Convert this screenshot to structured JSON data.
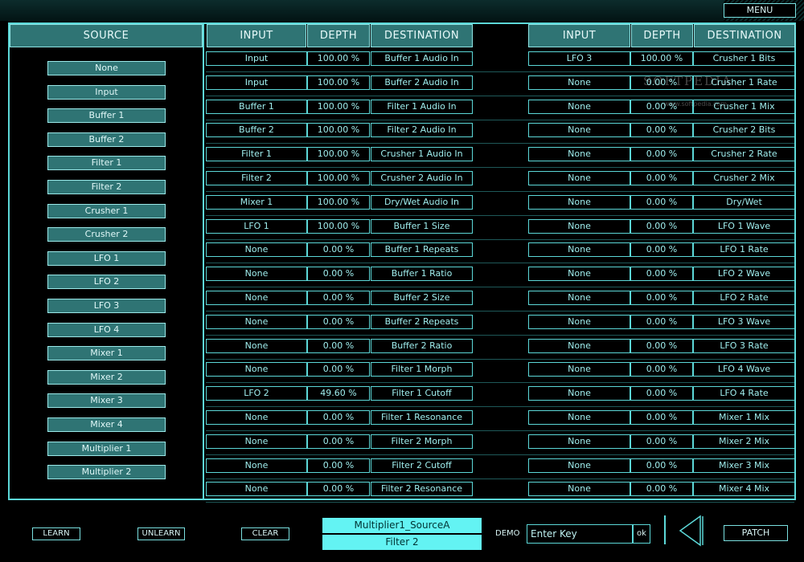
{
  "menu": {
    "label": "MENU"
  },
  "source": {
    "header": "SOURCE",
    "items": [
      "None",
      "Input",
      "Buffer 1",
      "Buffer 2",
      "Filter 1",
      "Filter 2",
      "Crusher 1",
      "Crusher 2",
      "LFO 1",
      "LFO 2",
      "LFO 3",
      "LFO 4",
      "Mixer 1",
      "Mixer 2",
      "Mixer 3",
      "Mixer 4",
      "Multiplier 1",
      "Multiplier 2"
    ]
  },
  "matrix": {
    "headers": {
      "input": "INPUT",
      "depth": "DEPTH",
      "destination": "DESTINATION"
    },
    "left": [
      {
        "input": "Input",
        "depth": "100.00 %",
        "destination": "Buffer 1 Audio In"
      },
      {
        "input": "Input",
        "depth": "100.00 %",
        "destination": "Buffer 2 Audio In"
      },
      {
        "input": "Buffer 1",
        "depth": "100.00 %",
        "destination": "Filter 1 Audio In"
      },
      {
        "input": "Buffer 2",
        "depth": "100.00 %",
        "destination": "Filter 2 Audio In"
      },
      {
        "input": "Filter 1",
        "depth": "100.00 %",
        "destination": "Crusher 1 Audio In"
      },
      {
        "input": "Filter 2",
        "depth": "100.00 %",
        "destination": "Crusher 2 Audio In"
      },
      {
        "input": "Mixer 1",
        "depth": "100.00 %",
        "destination": "Dry/Wet Audio In"
      },
      {
        "input": "LFO 1",
        "depth": "100.00 %",
        "destination": "Buffer 1 Size"
      },
      {
        "input": "None",
        "depth": "0.00 %",
        "destination": "Buffer 1 Repeats"
      },
      {
        "input": "None",
        "depth": "0.00 %",
        "destination": "Buffer 1 Ratio"
      },
      {
        "input": "None",
        "depth": "0.00 %",
        "destination": "Buffer 2 Size"
      },
      {
        "input": "None",
        "depth": "0.00 %",
        "destination": "Buffer 2 Repeats"
      },
      {
        "input": "None",
        "depth": "0.00 %",
        "destination": "Buffer 2 Ratio"
      },
      {
        "input": "None",
        "depth": "0.00 %",
        "destination": "Filter 1 Morph"
      },
      {
        "input": "LFO 2",
        "depth": "49.60 %",
        "destination": "Filter 1 Cutoff"
      },
      {
        "input": "None",
        "depth": "0.00 %",
        "destination": "Filter 1 Resonance"
      },
      {
        "input": "None",
        "depth": "0.00 %",
        "destination": "Filter 2 Morph"
      },
      {
        "input": "None",
        "depth": "0.00 %",
        "destination": "Filter 2 Cutoff"
      },
      {
        "input": "None",
        "depth": "0.00 %",
        "destination": "Filter 2 Resonance"
      }
    ],
    "right": [
      {
        "input": "LFO 3",
        "depth": "100.00 %",
        "destination": "Crusher 1 Bits"
      },
      {
        "input": "None",
        "depth": "0.00 %",
        "destination": "Crusher 1 Rate"
      },
      {
        "input": "None",
        "depth": "0.00 %",
        "destination": "Crusher 1 Mix"
      },
      {
        "input": "None",
        "depth": "0.00 %",
        "destination": "Crusher 2 Bits"
      },
      {
        "input": "None",
        "depth": "0.00 %",
        "destination": "Crusher 2 Rate"
      },
      {
        "input": "None",
        "depth": "0.00 %",
        "destination": "Crusher 2 Mix"
      },
      {
        "input": "None",
        "depth": "0.00 %",
        "destination": "Dry/Wet"
      },
      {
        "input": "None",
        "depth": "0.00 %",
        "destination": "LFO 1 Wave"
      },
      {
        "input": "None",
        "depth": "0.00 %",
        "destination": "LFO 1 Rate"
      },
      {
        "input": "None",
        "depth": "0.00 %",
        "destination": "LFO 2 Wave"
      },
      {
        "input": "None",
        "depth": "0.00 %",
        "destination": "LFO 2 Rate"
      },
      {
        "input": "None",
        "depth": "0.00 %",
        "destination": "LFO 3 Wave"
      },
      {
        "input": "None",
        "depth": "0.00 %",
        "destination": "LFO 3 Rate"
      },
      {
        "input": "None",
        "depth": "0.00 %",
        "destination": "LFO 4 Wave"
      },
      {
        "input": "None",
        "depth": "0.00 %",
        "destination": "LFO 4 Rate"
      },
      {
        "input": "None",
        "depth": "0.00 %",
        "destination": "Mixer 1 Mix"
      },
      {
        "input": "None",
        "depth": "0.00 %",
        "destination": "Mixer 2 Mix"
      },
      {
        "input": "None",
        "depth": "0.00 %",
        "destination": "Mixer 3 Mix"
      },
      {
        "input": "None",
        "depth": "0.00 %",
        "destination": "Mixer 4 Mix"
      }
    ]
  },
  "bottom": {
    "learn": "LEARN",
    "unlearn": "UNLEARN",
    "clear": "CLEAR",
    "info_line1": "Multiplier1_SourceA",
    "info_line2": "Filter 2",
    "demo": "DEMO",
    "key_placeholder": "Enter Key",
    "ok": "ok",
    "patch": "PATCH"
  },
  "watermark": {
    "text": "SOFTPEDIA",
    "sub": "www.softpedia.com"
  },
  "colors": {
    "accent": "#5cd8d8",
    "header_bg": "#2f7474",
    "info_bg": "#63f3f3"
  },
  "icons": {
    "back": "triangle-left-icon"
  }
}
